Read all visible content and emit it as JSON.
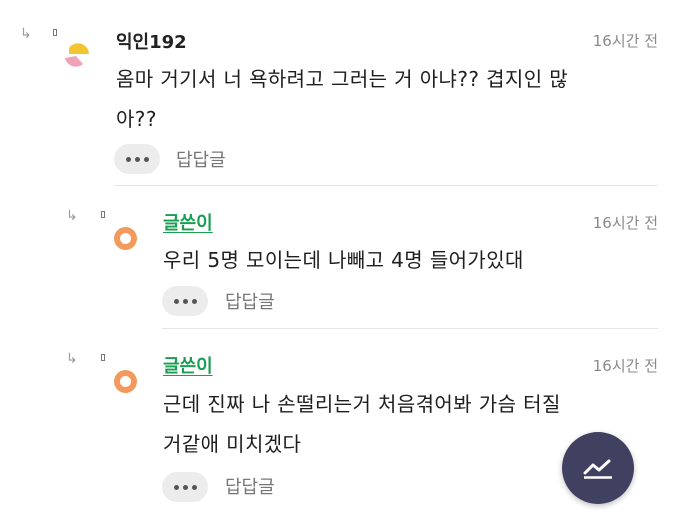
{
  "comments": [
    {
      "author": "익인192",
      "time": "16시간 전",
      "text_lines": [
        "옴마 거기서 너 욕하려고 그러는 거 아냐?? 겹지인 많",
        "아??"
      ],
      "reply_label": "답답글",
      "avatar_colors": [
        "#f2c531",
        "#f2a2b8"
      ]
    },
    {
      "author": "글쓴이",
      "time": "16시간 전",
      "text_lines": [
        "우리 5명 모이는데 나빼고 4명 들어가있대"
      ],
      "reply_label": "답답글",
      "avatar_colors": [
        "#f29a5c",
        "#ffffff"
      ]
    },
    {
      "author": "글쓴이",
      "time": "16시간 전",
      "text_lines": [
        "근데 진짜 나 손떨리는거 처음겪어봐 가슴 터질",
        "거같애 미치겠다"
      ],
      "reply_label": "답답글",
      "avatar_colors": [
        "#f29a5c",
        "#ffffff"
      ]
    }
  ],
  "icons": {
    "reply_arrow": "reply-arrow-icon",
    "more": "more-dots-icon",
    "fab": "trending-chart-icon"
  },
  "colors": {
    "op_author": "#1a9e52",
    "fab_background": "#404060"
  }
}
